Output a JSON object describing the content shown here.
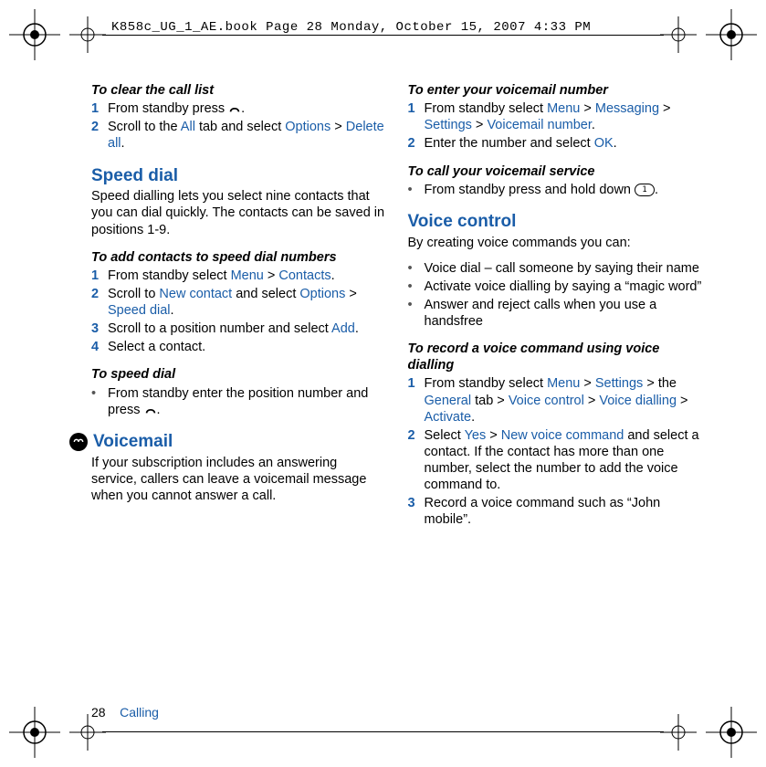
{
  "header": {
    "runner": "K858c_UG_1_AE.book  Page 28  Monday, October 15, 2007  4:33 PM"
  },
  "footer": {
    "page_num": "28",
    "section": "Calling"
  },
  "col1": {
    "clear_title": "To clear the call list",
    "clear_1_pre": "From standby press ",
    "clear_1_post": ".",
    "clear_2_pre": "Scroll to the ",
    "clear_2_all": "All",
    "clear_2_mid": " tab and select ",
    "clear_2_opt": "Options",
    "clear_2_gt": " > ",
    "clear_2_del": "Delete all",
    "clear_2_post": ".",
    "speed_h": "Speed dial",
    "speed_body": "Speed dialling lets you select nine contacts that you can dial quickly. The contacts can be saved in positions 1-9.",
    "add_title": "To add contacts to speed dial numbers",
    "add_1_pre": "From standby select ",
    "add_1_menu": "Menu",
    "add_1_gt": " > ",
    "add_1_contacts": "Contacts",
    "add_1_post": ".",
    "add_2_pre": "Scroll to ",
    "add_2_new": "New contact",
    "add_2_mid": " and select ",
    "add_2_opt": "Options",
    "add_2_gt": " > ",
    "add_2_sd": "Speed dial",
    "add_2_post": ".",
    "add_3_pre": "Scroll to a position number and select ",
    "add_3_add": "Add",
    "add_3_post": ".",
    "add_4": "Select a contact.",
    "tsd_title": "To speed dial",
    "tsd_1_pre": "From standby enter the position number and press ",
    "tsd_1_post": ".",
    "vm_h": "Voicemail",
    "vm_body": "If your subscription includes an answering service, callers can leave a voicemail message when you cannot answer a call."
  },
  "col2": {
    "enter_title": "To enter your voicemail number",
    "enter_1_pre": "From standby select ",
    "enter_1_menu": "Menu",
    "enter_1_gt1": " > ",
    "enter_1_msg": "Messaging",
    "enter_1_gt2": " > ",
    "enter_1_set": "Settings",
    "enter_1_gt3": " > ",
    "enter_1_vn": "Voicemail number",
    "enter_1_post": ".",
    "enter_2_pre": "Enter the number and select ",
    "enter_2_ok": "OK",
    "enter_2_post": ".",
    "call_title": "To call your voicemail service",
    "call_1_pre": "From standby press and hold down ",
    "call_1_post": ".",
    "vc_h": "Voice control",
    "vc_body": "By creating voice commands you can:",
    "vc_b1": "Voice dial – call someone by saying their name",
    "vc_b2": "Activate voice dialling by saying a “magic word”",
    "vc_b3": "Answer and reject calls when you use a handsfree",
    "rec_title": "To record a voice command using voice dialling",
    "rec_1_pre": "From standby select ",
    "rec_1_menu": "Menu",
    "rec_1_gt1": " > ",
    "rec_1_set": "Settings",
    "rec_1_mid": " > the ",
    "rec_1_gen": "General",
    "rec_1_mid2": " tab > ",
    "rec_1_vc": "Voice control",
    "rec_1_gt2": " > ",
    "rec_1_vd": "Voice dialling",
    "rec_1_gt3": " > ",
    "rec_1_act": "Activate",
    "rec_1_post": ".",
    "rec_2_pre": "Select ",
    "rec_2_yes": "Yes",
    "rec_2_gt": " > ",
    "rec_2_nvc": "New voice command",
    "rec_2_post": " and select a contact. If the contact has more than one number, select the number to add the voice command to.",
    "rec_3": "Record a voice command such as “John mobile”."
  },
  "nums": {
    "n1": "1",
    "n2": "2",
    "n3": "3",
    "n4": "4"
  },
  "key": {
    "one": "1"
  }
}
